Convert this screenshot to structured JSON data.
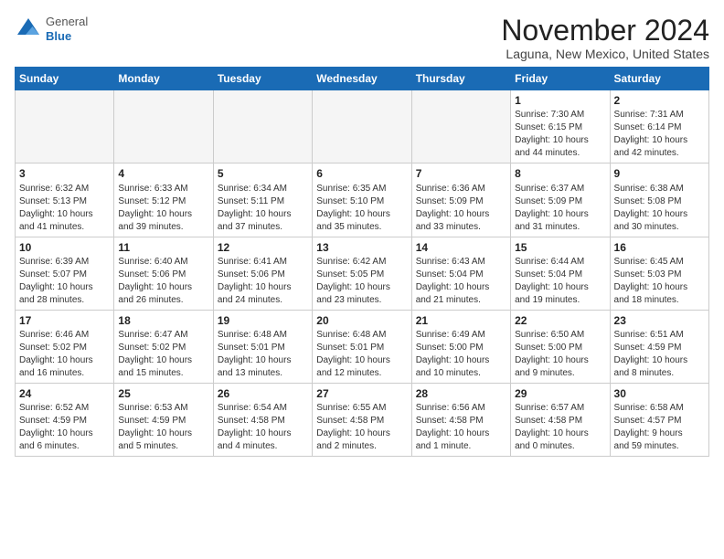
{
  "header": {
    "logo_line1": "General",
    "logo_line2": "Blue",
    "month": "November 2024",
    "location": "Laguna, New Mexico, United States"
  },
  "weekdays": [
    "Sunday",
    "Monday",
    "Tuesday",
    "Wednesday",
    "Thursday",
    "Friday",
    "Saturday"
  ],
  "weeks": [
    [
      {
        "day": "",
        "content": ""
      },
      {
        "day": "",
        "content": ""
      },
      {
        "day": "",
        "content": ""
      },
      {
        "day": "",
        "content": ""
      },
      {
        "day": "",
        "content": ""
      },
      {
        "day": "1",
        "content": "Sunrise: 7:30 AM\nSunset: 6:15 PM\nDaylight: 10 hours\nand 44 minutes."
      },
      {
        "day": "2",
        "content": "Sunrise: 7:31 AM\nSunset: 6:14 PM\nDaylight: 10 hours\nand 42 minutes."
      }
    ],
    [
      {
        "day": "3",
        "content": "Sunrise: 6:32 AM\nSunset: 5:13 PM\nDaylight: 10 hours\nand 41 minutes."
      },
      {
        "day": "4",
        "content": "Sunrise: 6:33 AM\nSunset: 5:12 PM\nDaylight: 10 hours\nand 39 minutes."
      },
      {
        "day": "5",
        "content": "Sunrise: 6:34 AM\nSunset: 5:11 PM\nDaylight: 10 hours\nand 37 minutes."
      },
      {
        "day": "6",
        "content": "Sunrise: 6:35 AM\nSunset: 5:10 PM\nDaylight: 10 hours\nand 35 minutes."
      },
      {
        "day": "7",
        "content": "Sunrise: 6:36 AM\nSunset: 5:09 PM\nDaylight: 10 hours\nand 33 minutes."
      },
      {
        "day": "8",
        "content": "Sunrise: 6:37 AM\nSunset: 5:09 PM\nDaylight: 10 hours\nand 31 minutes."
      },
      {
        "day": "9",
        "content": "Sunrise: 6:38 AM\nSunset: 5:08 PM\nDaylight: 10 hours\nand 30 minutes."
      }
    ],
    [
      {
        "day": "10",
        "content": "Sunrise: 6:39 AM\nSunset: 5:07 PM\nDaylight: 10 hours\nand 28 minutes."
      },
      {
        "day": "11",
        "content": "Sunrise: 6:40 AM\nSunset: 5:06 PM\nDaylight: 10 hours\nand 26 minutes."
      },
      {
        "day": "12",
        "content": "Sunrise: 6:41 AM\nSunset: 5:06 PM\nDaylight: 10 hours\nand 24 minutes."
      },
      {
        "day": "13",
        "content": "Sunrise: 6:42 AM\nSunset: 5:05 PM\nDaylight: 10 hours\nand 23 minutes."
      },
      {
        "day": "14",
        "content": "Sunrise: 6:43 AM\nSunset: 5:04 PM\nDaylight: 10 hours\nand 21 minutes."
      },
      {
        "day": "15",
        "content": "Sunrise: 6:44 AM\nSunset: 5:04 PM\nDaylight: 10 hours\nand 19 minutes."
      },
      {
        "day": "16",
        "content": "Sunrise: 6:45 AM\nSunset: 5:03 PM\nDaylight: 10 hours\nand 18 minutes."
      }
    ],
    [
      {
        "day": "17",
        "content": "Sunrise: 6:46 AM\nSunset: 5:02 PM\nDaylight: 10 hours\nand 16 minutes."
      },
      {
        "day": "18",
        "content": "Sunrise: 6:47 AM\nSunset: 5:02 PM\nDaylight: 10 hours\nand 15 minutes."
      },
      {
        "day": "19",
        "content": "Sunrise: 6:48 AM\nSunset: 5:01 PM\nDaylight: 10 hours\nand 13 minutes."
      },
      {
        "day": "20",
        "content": "Sunrise: 6:48 AM\nSunset: 5:01 PM\nDaylight: 10 hours\nand 12 minutes."
      },
      {
        "day": "21",
        "content": "Sunrise: 6:49 AM\nSunset: 5:00 PM\nDaylight: 10 hours\nand 10 minutes."
      },
      {
        "day": "22",
        "content": "Sunrise: 6:50 AM\nSunset: 5:00 PM\nDaylight: 10 hours\nand 9 minutes."
      },
      {
        "day": "23",
        "content": "Sunrise: 6:51 AM\nSunset: 4:59 PM\nDaylight: 10 hours\nand 8 minutes."
      }
    ],
    [
      {
        "day": "24",
        "content": "Sunrise: 6:52 AM\nSunset: 4:59 PM\nDaylight: 10 hours\nand 6 minutes."
      },
      {
        "day": "25",
        "content": "Sunrise: 6:53 AM\nSunset: 4:59 PM\nDaylight: 10 hours\nand 5 minutes."
      },
      {
        "day": "26",
        "content": "Sunrise: 6:54 AM\nSunset: 4:58 PM\nDaylight: 10 hours\nand 4 minutes."
      },
      {
        "day": "27",
        "content": "Sunrise: 6:55 AM\nSunset: 4:58 PM\nDaylight: 10 hours\nand 2 minutes."
      },
      {
        "day": "28",
        "content": "Sunrise: 6:56 AM\nSunset: 4:58 PM\nDaylight: 10 hours\nand 1 minute."
      },
      {
        "day": "29",
        "content": "Sunrise: 6:57 AM\nSunset: 4:58 PM\nDaylight: 10 hours\nand 0 minutes."
      },
      {
        "day": "30",
        "content": "Sunrise: 6:58 AM\nSunset: 4:57 PM\nDaylight: 9 hours\nand 59 minutes."
      }
    ]
  ]
}
